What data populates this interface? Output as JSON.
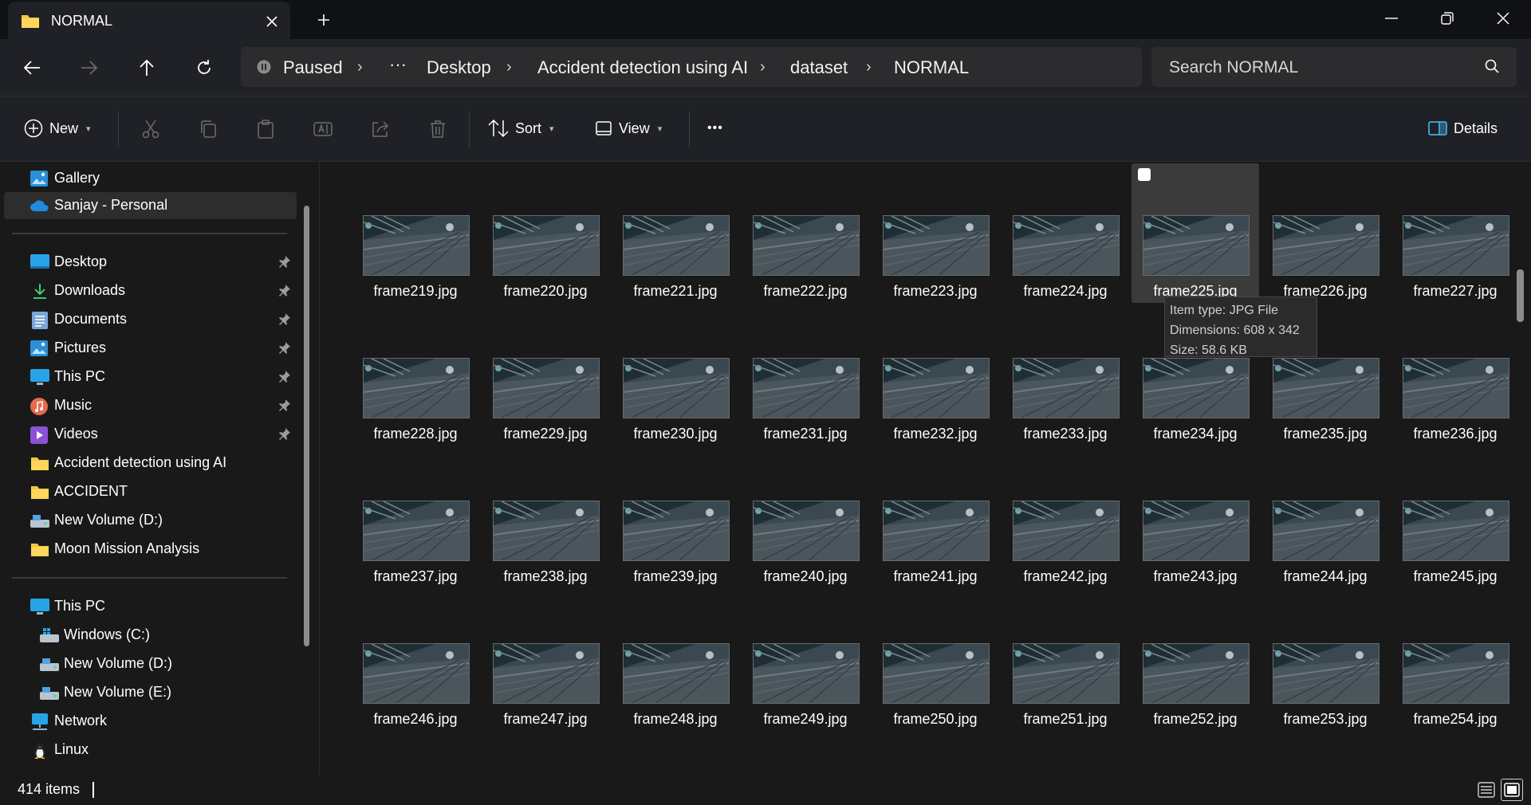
{
  "window": {
    "tab_title": "NORMAL",
    "tab_icon": "folder-icon",
    "accent": "#0078d4"
  },
  "address": {
    "status": "Paused",
    "more": "···",
    "crumbs": [
      "Desktop",
      "Accident detection using AI",
      "dataset",
      "NORMAL"
    ]
  },
  "search": {
    "placeholder": "Search NORMAL"
  },
  "toolbar": {
    "new_label": "New",
    "sort_label": "Sort",
    "view_label": "View",
    "more_label": "•••",
    "details_label": "Details"
  },
  "sidebar": {
    "top": [
      {
        "label": "Gallery",
        "icon": "gallery-icon"
      },
      {
        "label": "Sanjay - Personal",
        "icon": "onedrive-cloud-icon",
        "selected": true
      }
    ],
    "quick_access": [
      {
        "label": "Desktop",
        "icon": "desktop-icon",
        "pinned": true
      },
      {
        "label": "Downloads",
        "icon": "download-icon",
        "pinned": true
      },
      {
        "label": "Documents",
        "icon": "documents-icon",
        "pinned": true
      },
      {
        "label": "Pictures",
        "icon": "pictures-icon",
        "pinned": true
      },
      {
        "label": "This PC",
        "icon": "monitor-icon",
        "pinned": true
      },
      {
        "label": "Music",
        "icon": "music-icon",
        "pinned": true
      },
      {
        "label": "Videos",
        "icon": "videos-icon",
        "pinned": true
      },
      {
        "label": "Accident detection using AI",
        "icon": "folder-icon",
        "pinned": false
      },
      {
        "label": "ACCIDENT",
        "icon": "folder-icon",
        "pinned": false
      },
      {
        "label": "New Volume (D:)",
        "icon": "drive-icon",
        "pinned": false
      },
      {
        "label": "Moon Mission Analysis",
        "icon": "folder-icon",
        "pinned": false
      }
    ],
    "this_pc": [
      {
        "label": "This PC",
        "icon": "monitor-icon"
      },
      {
        "label": "Windows (C:)",
        "icon": "windows-drive-icon"
      },
      {
        "label": "New Volume (D:)",
        "icon": "drive-icon"
      },
      {
        "label": "New Volume (E:)",
        "icon": "drive-icon"
      },
      {
        "label": "Network",
        "icon": "network-icon"
      },
      {
        "label": "Linux",
        "icon": "linux-penguin-icon"
      }
    ]
  },
  "files": [
    "frame219.jpg",
    "frame220.jpg",
    "frame221.jpg",
    "frame222.jpg",
    "frame223.jpg",
    "frame224.jpg",
    "frame225.jpg",
    "frame226.jpg",
    "frame227.jpg",
    "frame228.jpg",
    "frame229.jpg",
    "frame230.jpg",
    "frame231.jpg",
    "frame232.jpg",
    "frame233.jpg",
    "frame234.jpg",
    "frame235.jpg",
    "frame236.jpg",
    "frame237.jpg",
    "frame238.jpg",
    "frame239.jpg",
    "frame240.jpg",
    "frame241.jpg",
    "frame242.jpg",
    "frame243.jpg",
    "frame244.jpg",
    "frame245.jpg",
    "frame246.jpg",
    "frame247.jpg",
    "frame248.jpg",
    "frame249.jpg",
    "frame250.jpg",
    "frame251.jpg",
    "frame252.jpg",
    "frame253.jpg",
    "frame254.jpg"
  ],
  "hovered_file": "frame225.jpg",
  "tooltip": {
    "type": "Item type: JPG File",
    "dimensions": "Dimensions: 608 x 342",
    "size": "Size: 58.6 KB"
  },
  "status": {
    "count": "414 items"
  }
}
